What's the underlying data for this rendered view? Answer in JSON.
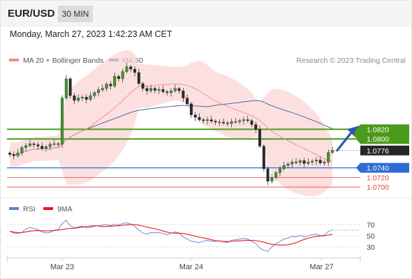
{
  "header": {
    "symbol": "EUR/USD",
    "timeframe": "30 MIN"
  },
  "datetime": "Monday, March 27, 2023 1:42:23 AM CET",
  "legend": [
    {
      "label": "MA 20 + Bollinger Bands",
      "color": "#f28b8b"
    },
    {
      "label": "MA 50",
      "color": "#355e9c"
    }
  ],
  "credit": "Research © 2023 Trading Central",
  "rsi_legend": [
    {
      "label": "RSI",
      "color": "#5b7fd6"
    },
    {
      "label": "9MA",
      "color": "#e8161b"
    }
  ],
  "colors": {
    "resistance": "#4c9a1c",
    "support": "#2f6bd4",
    "target": "#e8403f",
    "current": "#262626",
    "arrow": "#2a5aa8"
  },
  "chart_data": {
    "type": "candlestick",
    "x_ticks": [
      "Mar 23",
      "Mar 24",
      "Mar 27"
    ],
    "ylim": [
      1.068,
      1.098
    ],
    "levels": [
      {
        "price": 1.082,
        "label": "1.0820",
        "kind": "resistance"
      },
      {
        "price": 1.08,
        "label": "1.0800",
        "kind": "resistance"
      },
      {
        "price": 1.0776,
        "label": "1.0776",
        "kind": "current"
      },
      {
        "price": 1.074,
        "label": "1.0740",
        "kind": "pivot"
      },
      {
        "price": 1.072,
        "label": "1.0720",
        "kind": "target"
      },
      {
        "price": 1.07,
        "label": "1.0700",
        "kind": "target"
      }
    ],
    "closes": [
      1.0768,
      1.0765,
      1.0771,
      1.0782,
      1.0786,
      1.079,
      1.0788,
      1.0785,
      1.078,
      1.0784,
      1.0789,
      1.079,
      1.0789,
      1.0885,
      1.0925,
      1.089,
      1.088,
      1.0885,
      1.0887,
      1.0882,
      1.089,
      1.0896,
      1.0902,
      1.0905,
      1.0914,
      1.091,
      1.093,
      1.0925,
      1.094,
      1.095,
      1.0945,
      1.0938,
      1.0915,
      1.0905,
      1.09,
      1.0905,
      1.0901,
      1.0903,
      1.0898,
      1.0896,
      1.09,
      1.0905,
      1.09,
      1.0885,
      1.0873,
      1.085,
      1.0845,
      1.084,
      1.0838,
      1.084,
      1.0837,
      1.0835,
      1.0835,
      1.0833,
      1.0832,
      1.0836,
      1.0836,
      1.0838,
      1.084,
      1.0838,
      1.083,
      1.082,
      1.0785,
      1.0738,
      1.0712,
      1.072,
      1.073,
      1.0738,
      1.0745,
      1.0748,
      1.0752,
      1.0751,
      1.0755,
      1.0749,
      1.0752,
      1.0754,
      1.0756,
      1.075,
      1.0752,
      1.0772,
      1.0776
    ],
    "rsi": [
      58,
      55,
      54,
      56,
      62,
      65,
      63,
      61,
      57,
      55,
      56,
      60,
      61,
      72,
      78,
      68,
      64,
      66,
      67,
      64,
      65,
      67,
      68,
      69,
      70,
      68,
      71,
      69,
      72,
      73,
      71,
      67,
      60,
      55,
      53,
      56,
      55,
      56,
      54,
      52,
      54,
      57,
      55,
      48,
      44,
      40,
      39,
      38,
      40,
      42,
      40,
      40,
      41,
      39,
      38,
      42,
      43,
      44,
      45,
      44,
      40,
      36,
      28,
      24,
      22,
      30,
      36,
      40,
      44,
      46,
      49,
      48,
      51,
      48,
      50,
      52,
      53,
      50,
      51,
      58,
      60
    ],
    "rsi_levels": [
      70,
      50,
      30
    ]
  }
}
